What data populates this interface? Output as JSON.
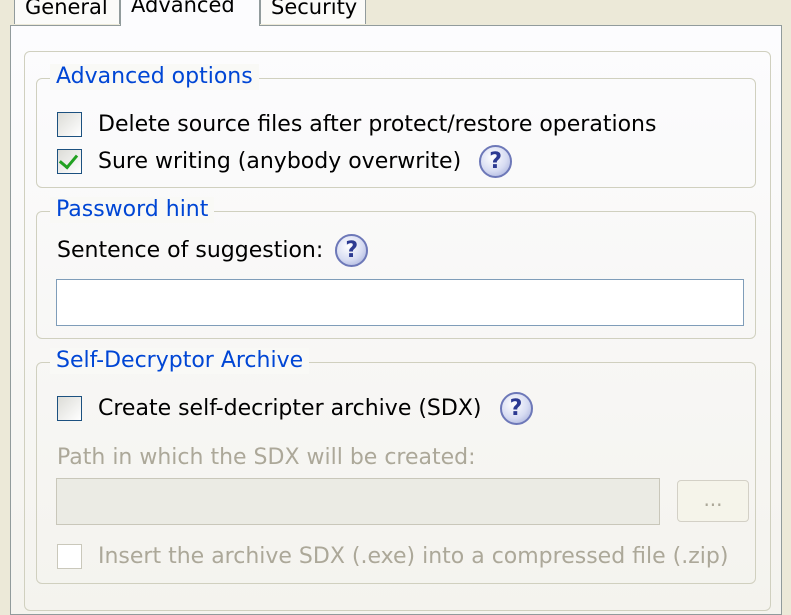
{
  "tabs": [
    {
      "label": "General"
    },
    {
      "label": "Advanced"
    },
    {
      "label": "Security"
    }
  ],
  "advanced_options": {
    "title": "Advanced options",
    "delete_source": {
      "label": "Delete source files after protect/restore operations",
      "checked": false
    },
    "sure_writing": {
      "label": "Sure writing (anybody overwrite)",
      "checked": true
    },
    "help": "?"
  },
  "password_hint": {
    "title": "Password hint",
    "sentence_label": "Sentence of suggestion:",
    "sentence_value": "",
    "help": "?"
  },
  "sdx": {
    "title": "Self-Decryptor Archive",
    "create": {
      "label": "Create self-decripter archive (SDX)",
      "checked": false
    },
    "help": "?",
    "path_label": "Path in which the SDX will be created:",
    "path_value": "",
    "browse_label": "...",
    "insert_zip": {
      "label": "Insert the archive SDX (.exe) into a compressed file (.zip)",
      "checked": false
    }
  }
}
